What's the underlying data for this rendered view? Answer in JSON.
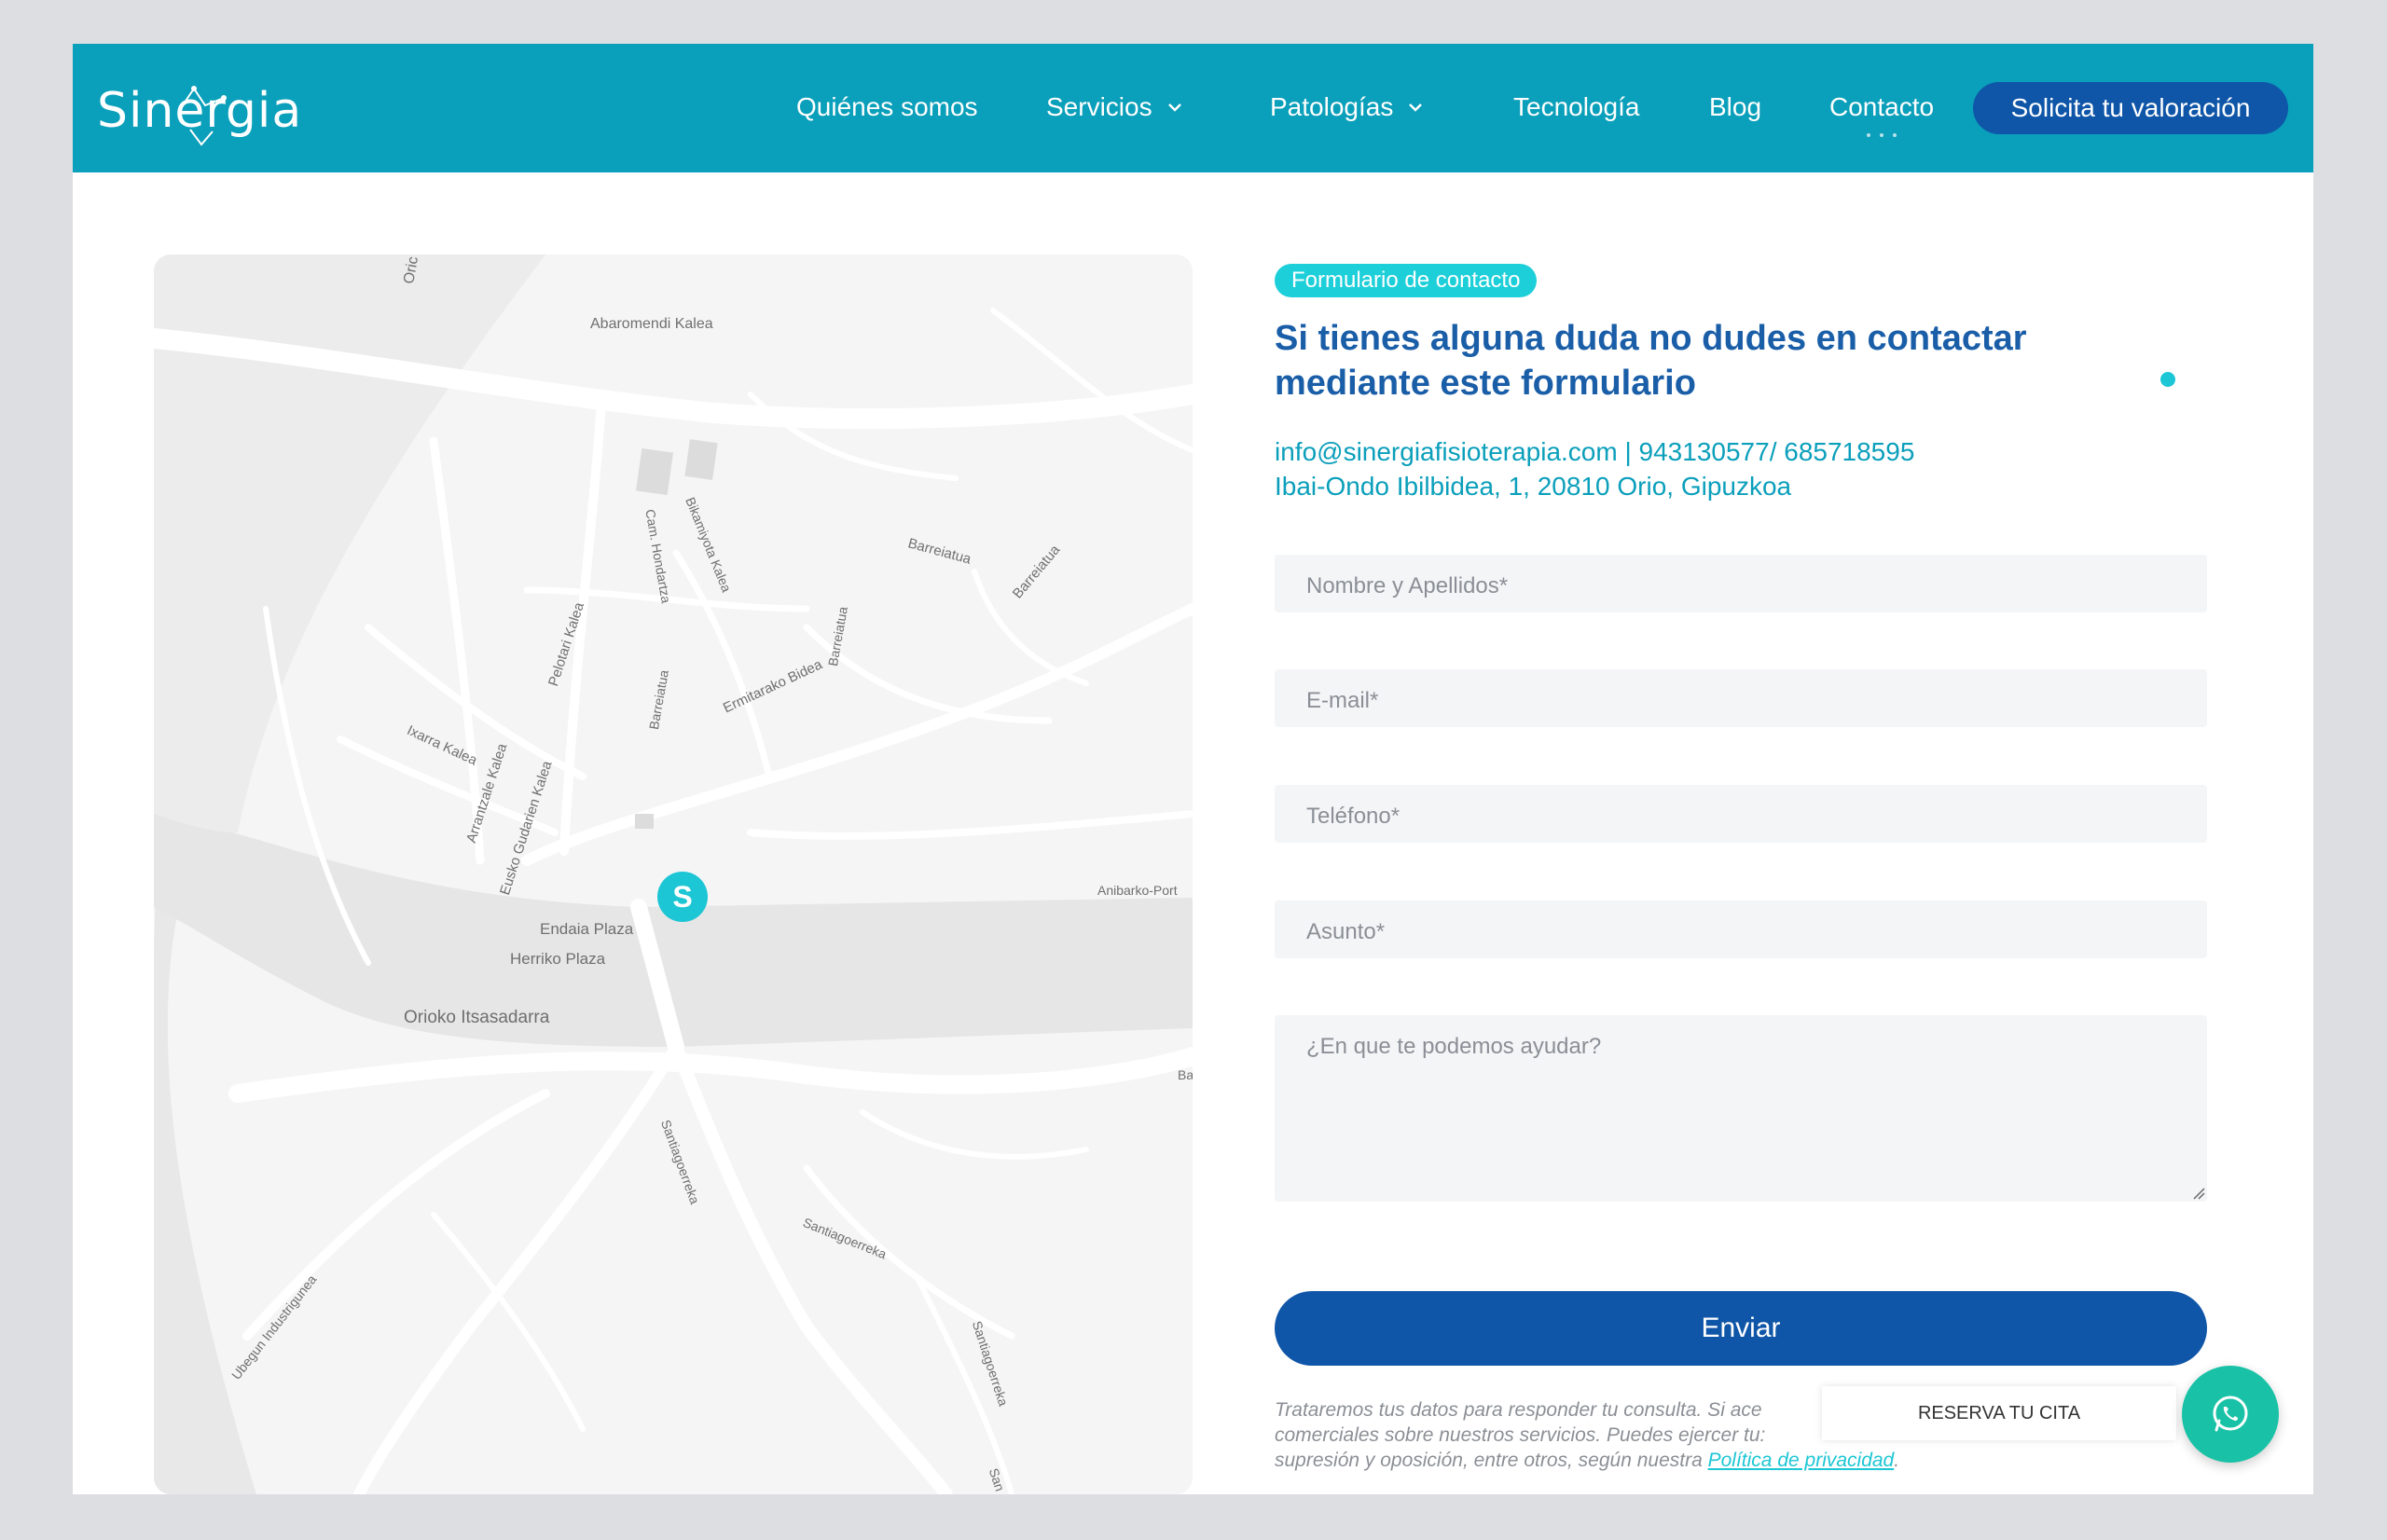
{
  "header": {
    "logo_text": "Sinergia",
    "nav": [
      {
        "label": "Quiénes somos"
      },
      {
        "label": "Servicios"
      },
      {
        "label": "Patologías"
      },
      {
        "label": "Tecnología"
      },
      {
        "label": "Blog"
      },
      {
        "label": "Contacto"
      }
    ],
    "cta_label": "Solicita tu valoración"
  },
  "map": {
    "labels": [
      "Oric",
      "Abaromendi Kalea",
      "Cam. Hondartza",
      "Bikamiyota Kalea",
      "Barreiatua",
      "Barreiatua",
      "Pelotari Kalea",
      "Barreiatua",
      "Ermitarako Bidea",
      "Barreiatua",
      "Ixarra Kalea",
      "Arrantzale Kalea",
      "Eusko Gudarien Kalea",
      "Anibarko-Port",
      "Endaia Plaza",
      "Herriko Plaza",
      "Orioko Itsasadarra",
      "Ba",
      "Santiagoerreka",
      "Santiagoerreka",
      "Ubegun Industrigunea",
      "Santiagoerreka",
      "San"
    ],
    "pin_letter": "S"
  },
  "form": {
    "badge": "Formulario de contacto",
    "title": "Si tienes alguna duda no dudes en contactar mediante este formulario",
    "contact_line_1": "info@sinergiafisioterapia.com | 943130577/ 685718595",
    "contact_line_2": "Ibai-Ondo Ibilbidea, 1, 20810 Orio, Gipuzkoa",
    "fields": {
      "name_placeholder": "Nombre y Apellidos*",
      "email_placeholder": "E-mail*",
      "phone_placeholder": "Teléfono*",
      "subject_placeholder": "Asunto*",
      "message_placeholder": "¿En que te podemos ayudar?"
    },
    "submit_label": "Enviar",
    "legal_line_1": "Trataremos tus datos para responder tu consulta. Si ace",
    "legal_line_2": "comerciales sobre nuestros servicios. Puedes ejercer tu:",
    "legal_line_3": "supresión y oposición, entre otros, según nuestra",
    "privacy_link": "Política de privacidad",
    "legal_end": "."
  },
  "floating": {
    "reserve_label": "RESERVA TU CITA"
  },
  "colors": {
    "header_bg": "#0a9fba",
    "primary_blue": "#0f56a8",
    "accent_teal": "#1cc6d5",
    "whatsapp_green": "#19c2a6"
  }
}
